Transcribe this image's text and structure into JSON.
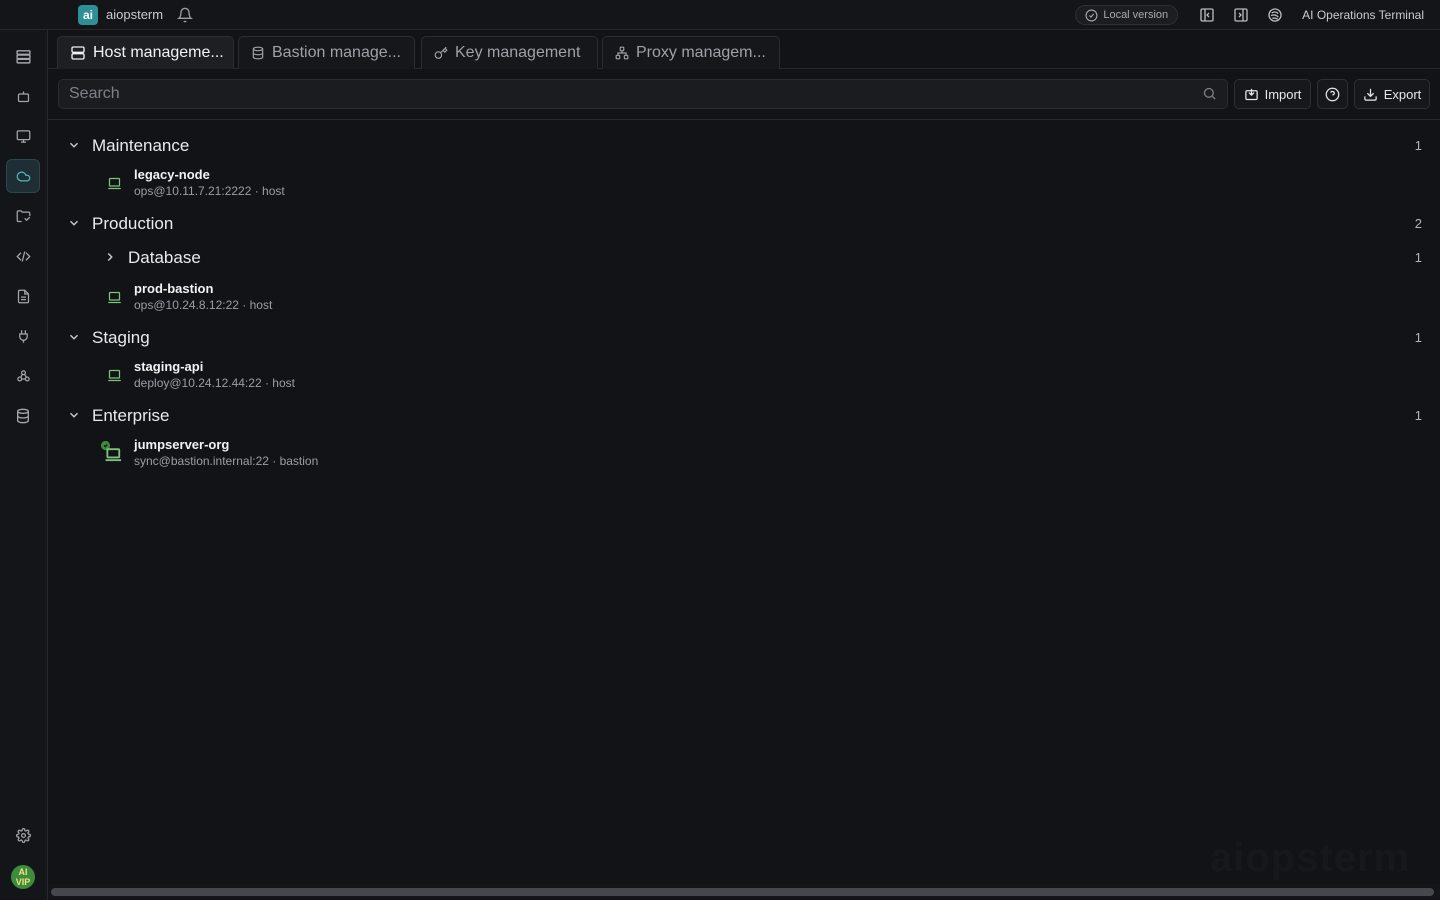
{
  "app": {
    "logo": "ai",
    "name": "aiopsterm",
    "local_version": "Local version",
    "window_title": "AI Operations Terminal"
  },
  "rail": {
    "items": [
      "hosts-icon",
      "bot-icon",
      "monitor-icon",
      "cloud-icon",
      "folder-sync-icon",
      "code-icon",
      "file-text-icon",
      "plug-icon",
      "cluster-icon",
      "database-icon"
    ],
    "active": "cloud-icon",
    "vip_top": "AI",
    "vip_bottom": "VIP"
  },
  "tabs": [
    {
      "label": "Host manageme...",
      "icon": "server-icon",
      "active": true
    },
    {
      "label": "Bastion manage...",
      "icon": "database-icon",
      "active": false
    },
    {
      "label": "Key management",
      "icon": "key-icon",
      "active": false
    },
    {
      "label": "Proxy managem...",
      "icon": "network-icon",
      "active": false
    }
  ],
  "toolbar": {
    "search_placeholder": "Search",
    "import_label": "Import",
    "export_label": "Export"
  },
  "groups": [
    {
      "label": "Maintenance",
      "count": "1",
      "expanded": true
    },
    {
      "label": "Production",
      "count": "2",
      "expanded": true
    },
    {
      "label": "Database",
      "count": "1",
      "expanded": false
    },
    {
      "label": "Staging",
      "count": "1",
      "expanded": true
    },
    {
      "label": "Enterprise",
      "count": "1",
      "expanded": true
    }
  ],
  "hosts": [
    {
      "name": "legacy-node",
      "detail": "ops@10.11.7.21:2222 · host",
      "type": "host"
    },
    {
      "name": "prod-bastion",
      "detail": "ops@10.24.8.12:22 · host",
      "type": "host"
    },
    {
      "name": "staging-api",
      "detail": "deploy@10.24.12.44:22 · host",
      "type": "host"
    },
    {
      "name": "jumpserver-org",
      "detail": "sync@bastion.internal:22 · bastion",
      "type": "bastion"
    }
  ],
  "watermark": "aiopsterm",
  "colors": {
    "background": "#121316",
    "accent": "#4fb6c2",
    "host_icon": "#7cc47e"
  }
}
